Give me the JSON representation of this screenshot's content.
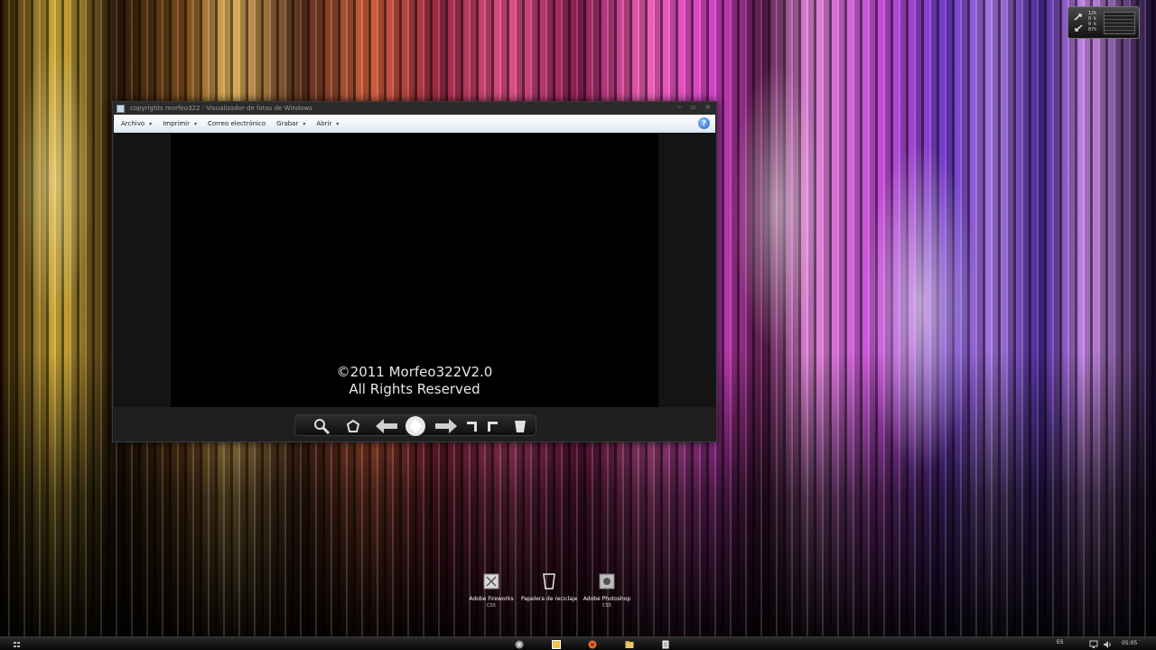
{
  "window": {
    "title": "copyrights morfeo322 - Visualizador de fotos de Windows",
    "menu": [
      {
        "label": "Archivo",
        "caret": "▾"
      },
      {
        "label": "Imprimir",
        "caret": "▾"
      },
      {
        "label": "Correo electrónico",
        "caret": ""
      },
      {
        "label": "Grabar",
        "caret": "▾"
      },
      {
        "label": "Abrir",
        "caret": "▾"
      }
    ],
    "help": "?",
    "photo_text": {
      "line1": "©2011 Morfeo322V2.0",
      "line2": "All Rights Reserved"
    },
    "controls": [
      "search-icon",
      "gallery-icon",
      "arrow-left-icon",
      "slideshow-icon",
      "arrow-right-icon",
      "rotate-left-icon",
      "rotate-right-icon",
      "delete-icon"
    ]
  },
  "desktop_icons": [
    {
      "label": "Adobe Fireworks",
      "sub": "CS5"
    },
    {
      "label": "Papelera de reciclaje",
      "sub": ""
    },
    {
      "label": "Adobe Photoshop",
      "sub": "CS5"
    }
  ],
  "gadget": {
    "lines": [
      "12%",
      "0 k",
      "0 k",
      "87%"
    ]
  },
  "taskbar": {
    "icons": [
      "start-icon",
      "chrome-icon",
      "photo-viewer-icon",
      "firefox-icon",
      "explorer-icon",
      "notepad-icon"
    ],
    "language": "ES",
    "time": "05:05"
  },
  "colors": {
    "menubar": "#eef3fa",
    "help": "#2a64c8"
  }
}
